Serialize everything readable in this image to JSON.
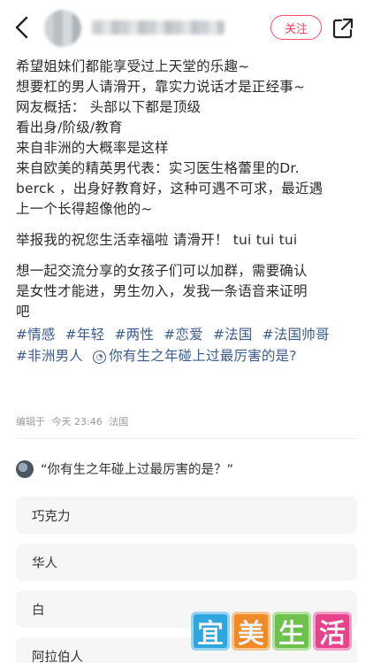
{
  "header": {
    "follow_label": "关注"
  },
  "post": {
    "lines_p1": [
      "希望姐妹们都能享受过上天堂的乐趣~",
      "想要杠的男人请滑开，靠实力说话才是正经事~",
      "网友概括： 头部以下都是顶级",
      "看出身/阶级/教育",
      "来自非洲的大概率是这样",
      "来自欧美的精英男代表：实习医生格蕾里的Dr.",
      "berck ，出身好教育好，这种可遇不可求，最近遇",
      "上一个长得超像他的~"
    ],
    "p2": "举报我的祝您生活幸福啦 请滑开！  tui tui tui",
    "lines_p3": [
      "想一起交流分享的女孩子们可以加群，需要确认",
      "是女性才能进，男生勿入，发我一条语音来证明",
      "吧"
    ],
    "tags_row1": [
      "#情感",
      "#年轻",
      "#两性",
      "#恋爱",
      "#法国",
      "#法国帅哥"
    ],
    "tags_row2": [
      "#非洲男人"
    ],
    "topic_link": "你有生之年碰上过最厉害的是?",
    "meta": {
      "edited": "编辑于",
      "time": "今天 23:46",
      "location": "法国"
    }
  },
  "poll": {
    "question": "“你有生之年碰上过最厉害的是？”",
    "options": [
      "巧克力",
      "华人",
      "白",
      "阿拉伯人"
    ]
  },
  "watermark": {
    "chars": [
      "宜",
      "美",
      "生",
      "活"
    ],
    "colors": [
      "#2ea7e0",
      "#f08a24",
      "#6cc24a",
      "#e8428c"
    ]
  },
  "colors": {
    "accent": "#ff3b5c",
    "tag": "#3b5c8f"
  }
}
